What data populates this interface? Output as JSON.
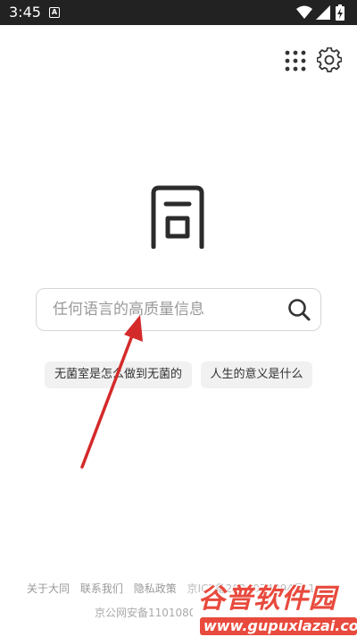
{
  "status_bar": {
    "time": "3:45",
    "notification_glyph": "A",
    "icons": [
      "wifi-icon",
      "signal-icon",
      "battery-icon"
    ]
  },
  "header": {
    "apps_icon": "grid-icon",
    "settings_icon": "gear-icon"
  },
  "logo": {
    "glyph": "同"
  },
  "search": {
    "placeholder": "任何语言的高质量信息",
    "value": "",
    "icon": "search-icon"
  },
  "suggestions": [
    {
      "label": "无菌室是怎么做到无菌的"
    },
    {
      "label": "人生的意义是什么"
    }
  ],
  "footer": {
    "links": [
      "关于大同",
      "联系我们",
      "隐私政策"
    ],
    "icp": "京ICP备2024074994号-1",
    "police_record": "京公网安备1101080"
  },
  "watermark": {
    "title": "谷普软件园",
    "url": "www.gupuxlazai.com"
  },
  "colors": {
    "status_bar_bg": "#222222",
    "annotation_arrow": "#d42a2a",
    "watermark": "#e84a3d"
  }
}
